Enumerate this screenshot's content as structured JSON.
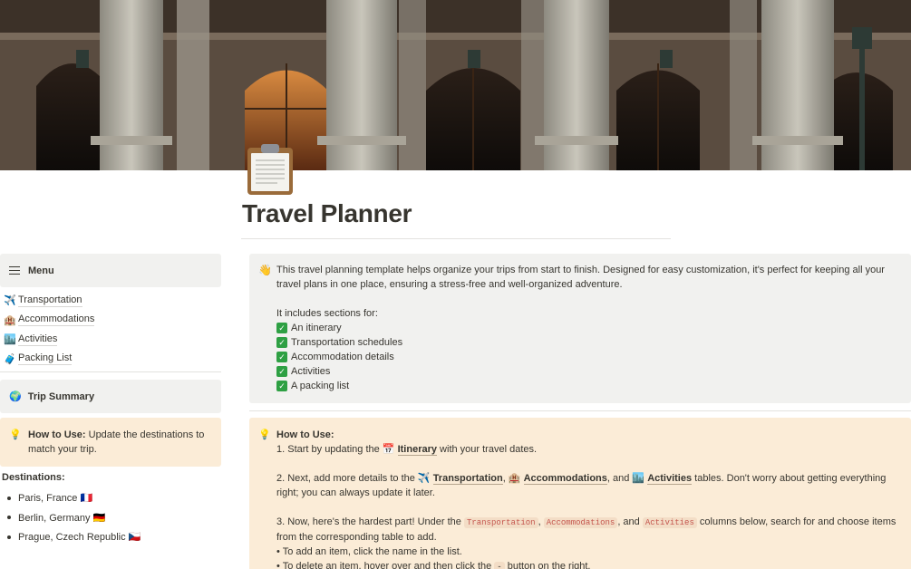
{
  "page": {
    "title": "Travel Planner",
    "icon": "clipboard-icon"
  },
  "sidebar": {
    "menu_label": "Menu",
    "items": [
      {
        "emoji": "✈️",
        "label": "Transportation"
      },
      {
        "emoji": "🏨",
        "label": "Accommodations"
      },
      {
        "emoji": "🏙️",
        "label": "Activities"
      },
      {
        "emoji": "🧳",
        "label": "Packing List"
      }
    ],
    "trip_summary": {
      "emoji": "🌍",
      "label": "Trip Summary"
    },
    "how_to": {
      "emoji": "💡",
      "bold": "How to Use:",
      "text": " Update the destinations to match your trip."
    },
    "destinations_label": "Destinations:",
    "destinations": [
      "Paris, France 🇫🇷",
      "Berlin, Germany 🇩🇪",
      "Prague, Czech Republic 🇨🇿"
    ]
  },
  "intro": {
    "emoji": "👋",
    "paragraph": "This travel planning template helps organize your trips from start to finish. Designed for easy customization, it's perfect for keeping all your travel plans in one place, ensuring a stress-free and well-organized adventure.",
    "includes": "It includes sections for:",
    "items": [
      "An itinerary",
      "Transportation schedules",
      "Accommodation details",
      "Activities",
      "A packing list"
    ]
  },
  "how_to_main": {
    "emoji": "💡",
    "heading": "How to Use:",
    "step1_a": "1. Start by updating the ",
    "step1_link": "Itinerary",
    "step1_b": " with your travel dates.",
    "step2_a": "2. Next, add more details to the ",
    "step2_link1": "Transportation",
    "step2_sep1": ", ",
    "step2_link2": "Accommodations",
    "step2_sep2": ", and ",
    "step2_link3": "Activities",
    "step2_b": " tables. Don't worry about getting everything right; you can always update it later.",
    "step3_a": "3. Now, here's the hardest part! Under the ",
    "step3_code1": "Transportation",
    "step3_sep1": ", ",
    "step3_code2": "Accommodations",
    "step3_sep2": ", and ",
    "step3_code3": "Activities",
    "step3_b": " columns below, search for and choose items from the corresponding table to add.",
    "bullet1": "• To add an item, click the name in the list.",
    "bullet2_a": "• To delete an item, hover over and then click the ",
    "bullet2_code": "-",
    "bullet2_b": " button on the right."
  }
}
